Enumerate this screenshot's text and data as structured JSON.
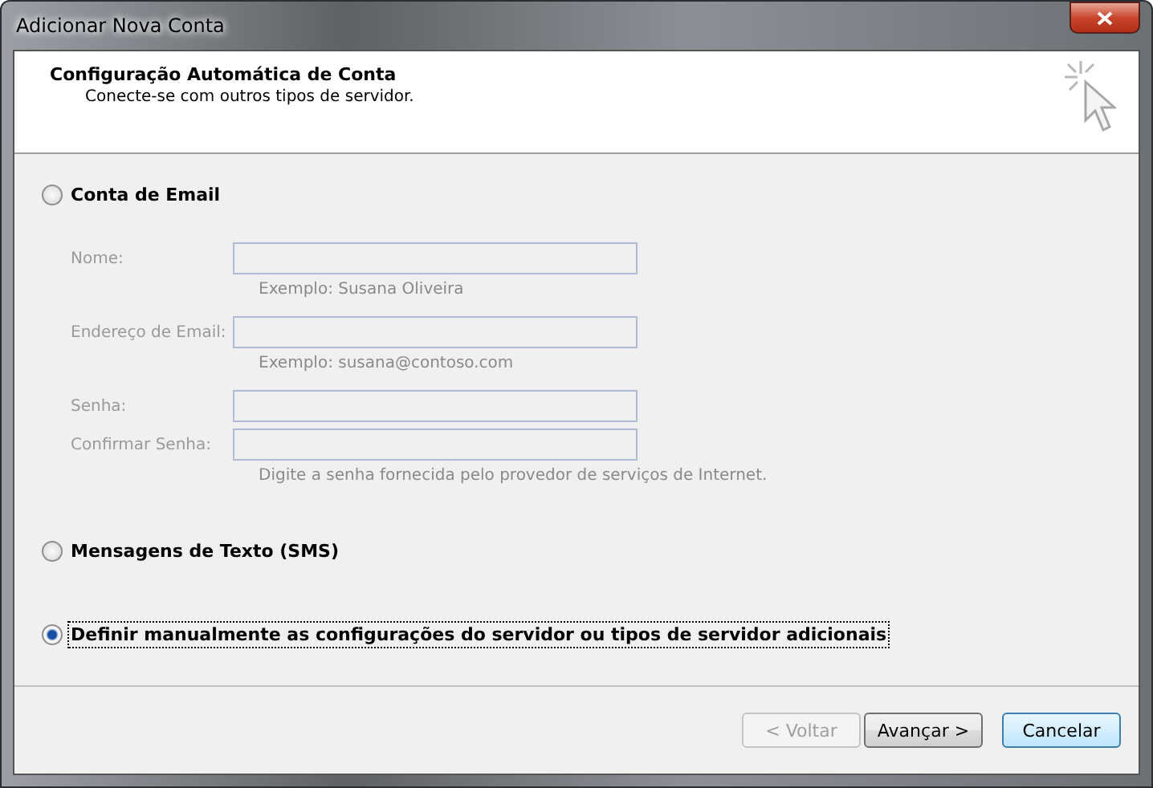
{
  "window": {
    "title": "Adicionar Nova Conta"
  },
  "header": {
    "title": "Configuração Automática de Conta",
    "subtitle": "Conecte-se com outros tipos de servidor."
  },
  "options": [
    {
      "label": "Conta de Email",
      "selected": false,
      "fields_disabled": true,
      "fields": [
        {
          "label": "Nome:",
          "hint": "Exemplo: Susana Oliveira"
        },
        {
          "label": "Endereço de Email:",
          "hint": "Exemplo: susana@contoso.com"
        },
        {
          "label": "Senha:"
        },
        {
          "label": "Confirmar Senha:",
          "hint": "Digite a senha fornecida pelo provedor de serviços de Internet."
        }
      ]
    },
    {
      "label": "Mensagens de Texto (SMS)",
      "selected": false
    },
    {
      "label": "Definir manualmente as configurações do servidor ou tipos de servidor adicionais",
      "selected": true
    }
  ],
  "buttons": [
    {
      "label": "< Voltar",
      "disabled": true,
      "default": false
    },
    {
      "label": "Avançar >",
      "disabled": false,
      "default": false
    },
    {
      "label": "Cancelar",
      "disabled": false,
      "default": true
    }
  ]
}
